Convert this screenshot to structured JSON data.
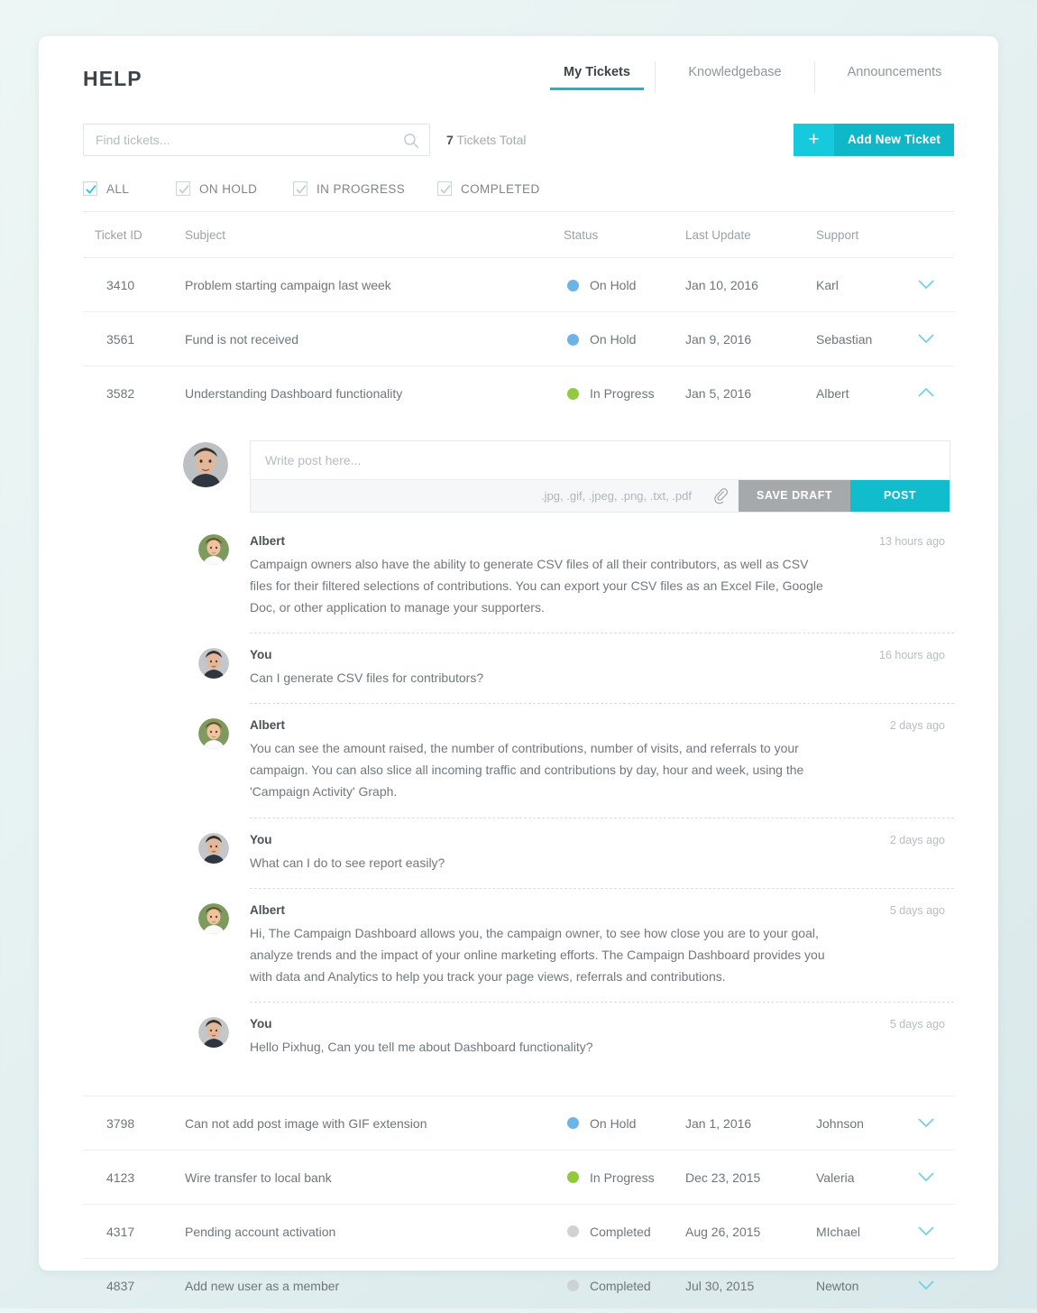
{
  "header": {
    "brand": "HELP",
    "tabs": [
      {
        "label": "My Tickets",
        "active": true
      },
      {
        "label": "Knowledgebase",
        "active": false
      },
      {
        "label": "Announcements",
        "active": false
      }
    ]
  },
  "toolbar": {
    "search_placeholder": "Find tickets...",
    "search_value": "",
    "search_icon": "search-icon",
    "tickets_count": "7",
    "tickets_total_label": " Tickets Total",
    "add_ticket_plus": "+",
    "add_ticket_label": "Add New Ticket"
  },
  "filters": [
    {
      "label": "ALL",
      "checked": true,
      "accent": "#2cc5d6"
    },
    {
      "label": "ON HOLD",
      "checked": true,
      "accent": "#c7cdd0"
    },
    {
      "label": "IN PROGRESS",
      "checked": true,
      "accent": "#c7cdd0"
    },
    {
      "label": "COMPLETED",
      "checked": true,
      "accent": "#c7cdd0"
    }
  ],
  "table": {
    "columns": {
      "ticket_id": "Ticket ID",
      "subject": "Subject",
      "status": "Status",
      "last_update": "Last Update",
      "support": "Support"
    },
    "rows": [
      {
        "id": "3410",
        "subject": "Problem starting campaign last week",
        "status": "On Hold",
        "status_color": "#6cb4e8",
        "last_update": "Jan 10, 2016",
        "support": "Karl",
        "expanded": false
      },
      {
        "id": "3561",
        "subject": "Fund is not received",
        "status": "On Hold",
        "status_color": "#6cb4e8",
        "last_update": "Jan 9, 2016",
        "support": "Sebastian",
        "expanded": false
      },
      {
        "id": "3582",
        "subject": "Understanding Dashboard functionality",
        "status": "In Progress",
        "status_color": "#94c83d",
        "last_update": "Jan 5, 2016",
        "support": "Albert",
        "expanded": true
      },
      {
        "id": "3798",
        "subject": "Can not add post image with GIF extension",
        "status": "On Hold",
        "status_color": "#6cb4e8",
        "last_update": "Jan 1, 2016",
        "support": "Johnson",
        "expanded": false
      },
      {
        "id": "4123",
        "subject": "Wire transfer to local bank",
        "status": "In Progress",
        "status_color": "#94c83d",
        "last_update": "Dec 23, 2015",
        "support": "Valeria",
        "expanded": false
      },
      {
        "id": "4317",
        "subject": "Pending account activation",
        "status": "Completed",
        "status_color": "#cdd2d4",
        "last_update": "Aug 26, 2015",
        "support": "MIchael",
        "expanded": false
      },
      {
        "id": "4837",
        "subject": "Add new user as a member",
        "status": "Completed",
        "status_color": "#cdd2d4",
        "last_update": "Jul 30, 2015",
        "support": "Newton",
        "expanded": false
      }
    ]
  },
  "composer": {
    "placeholder": "Write post here...",
    "value": "",
    "file_types": ".jpg, .gif, .jpeg, .png, .txt, .pdf",
    "attach_icon": "paperclip-icon",
    "save_draft_label": "SAVE DRAFT",
    "post_label": "POST"
  },
  "thread": [
    {
      "author": "Albert",
      "time": "13 hours ago",
      "avatar": "albert",
      "body": "Campaign owners also have the ability to generate CSV files of all their contributors, as well as CSV files for their filtered selections of contributions. You can export your CSV files as an Excel File, Google Doc, or other application to manage your supporters."
    },
    {
      "author": "You",
      "time": "16 hours ago",
      "avatar": "you",
      "body": "Can I generate CSV files for contributors?"
    },
    {
      "author": "Albert",
      "time": "2 days  ago",
      "avatar": "albert",
      "body": "You can see the amount raised, the number of contributions, number of visits, and referrals to your campaign. You can also slice all incoming traffic and contributions by day, hour and week, using the 'Campaign Activity' Graph."
    },
    {
      "author": "You",
      "time": "2 days ago",
      "avatar": "you",
      "body": "What can I do to see report easily?"
    },
    {
      "author": "Albert",
      "time": "5 days ago",
      "avatar": "albert",
      "body": "Hi, The Campaign Dashboard allows you, the campaign owner, to see how close you are to your goal, analyze trends and the impact of your online marketing efforts. The Campaign Dashboard provides you with data and Analytics to help you track your page views, referrals and contributions."
    },
    {
      "author": "You",
      "time": "5 days ago",
      "avatar": "you",
      "body": "Hello Pixhug, Can you tell me about Dashboard functionality?"
    }
  ],
  "colors": {
    "accent": "#11bccd",
    "accent_light": "#17c9dc",
    "on_hold": "#6cb4e8",
    "in_progress": "#94c83d",
    "completed": "#cdd2d4",
    "page_bg": "#eaf4f3"
  }
}
